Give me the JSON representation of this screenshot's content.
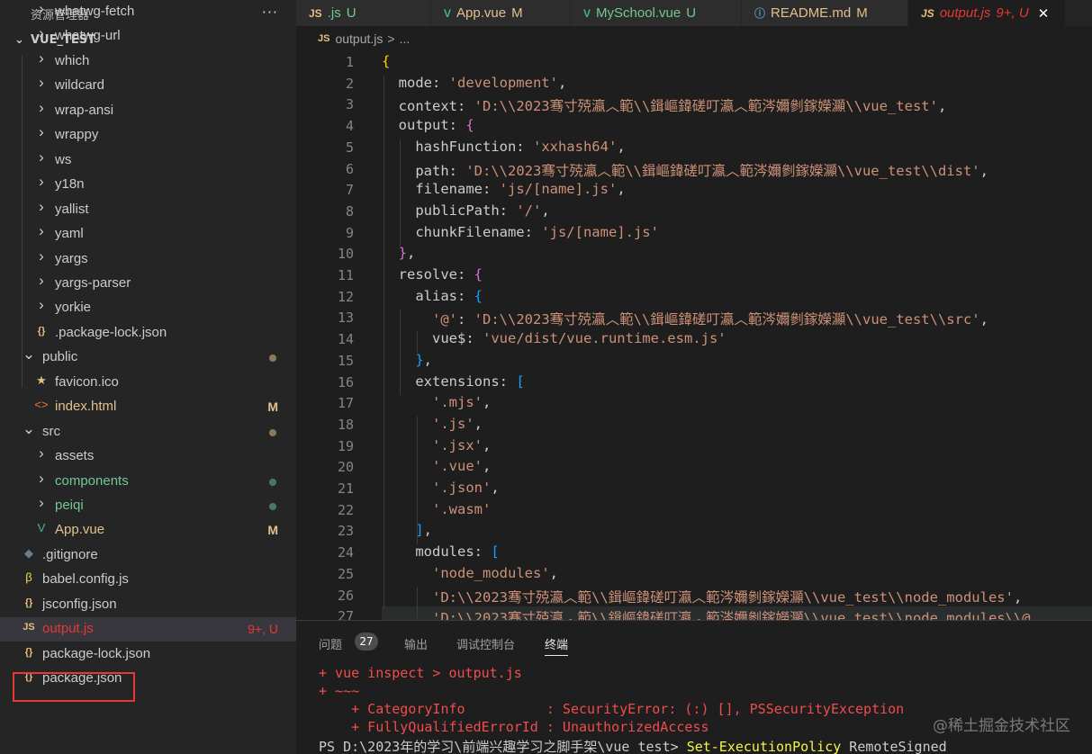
{
  "sidebar": {
    "header": "资源管理器",
    "more": "···",
    "section": "VUE_TEST",
    "items": [
      {
        "label": "whatwg-fetch",
        "icon": "chevron-right-icon",
        "kind": "folder"
      },
      {
        "label": "whatwg-url",
        "icon": "chevron-right-icon",
        "kind": "folder"
      },
      {
        "label": "which",
        "icon": "chevron-right-icon",
        "kind": "folder"
      },
      {
        "label": "wildcard",
        "icon": "chevron-right-icon",
        "kind": "folder"
      },
      {
        "label": "wrap-ansi",
        "icon": "chevron-right-icon",
        "kind": "folder"
      },
      {
        "label": "wrappy",
        "icon": "chevron-right-icon",
        "kind": "folder"
      },
      {
        "label": "ws",
        "icon": "chevron-right-icon",
        "kind": "folder"
      },
      {
        "label": "y18n",
        "icon": "chevron-right-icon",
        "kind": "folder"
      },
      {
        "label": "yallist",
        "icon": "chevron-right-icon",
        "kind": "folder"
      },
      {
        "label": "yaml",
        "icon": "chevron-right-icon",
        "kind": "folder"
      },
      {
        "label": "yargs",
        "icon": "chevron-right-icon",
        "kind": "folder"
      },
      {
        "label": "yargs-parser",
        "icon": "chevron-right-icon",
        "kind": "folder"
      },
      {
        "label": "yorkie",
        "icon": "chevron-right-icon",
        "kind": "folder"
      },
      {
        "label": ".package-lock.json",
        "icon": "json-braces-icon",
        "kind": "json"
      },
      {
        "label": "public",
        "icon": "chevron-down-icon",
        "kind": "open"
      },
      {
        "label": "favicon.ico",
        "icon": "star-icon",
        "kind": "ico"
      },
      {
        "label": "index.html",
        "icon": "html-icon",
        "kind": "html",
        "badge": "M"
      },
      {
        "label": "src",
        "icon": "chevron-down-icon",
        "kind": "open"
      },
      {
        "label": "assets",
        "icon": "chevron-right-icon",
        "kind": "folder"
      },
      {
        "label": "components",
        "icon": "chevron-right-icon",
        "kind": "folder-green"
      },
      {
        "label": "peiqi",
        "icon": "chevron-right-icon",
        "kind": "folder-green"
      },
      {
        "label": "App.vue",
        "icon": "vue-icon",
        "kind": "vue",
        "badge": "M"
      },
      {
        "label": ".gitignore",
        "icon": "git-icon",
        "kind": "git"
      },
      {
        "label": "babel.config.js",
        "icon": "babel-icon",
        "kind": "babel"
      },
      {
        "label": "jsconfig.json",
        "icon": "json-braces-icon",
        "kind": "json"
      },
      {
        "label": "output.js",
        "icon": "js-icon",
        "kind": "js",
        "badge": "9+, U"
      },
      {
        "label": "package-lock.json",
        "icon": "json-braces-icon",
        "kind": "json"
      },
      {
        "label": "package.json",
        "icon": "json-braces-icon",
        "kind": "json"
      }
    ]
  },
  "tabs": [
    {
      "icon": "JS",
      "label": ".js",
      "status": "U"
    },
    {
      "icon": "V",
      "label": "App.vue",
      "status": "M"
    },
    {
      "icon": "V",
      "label": "MySchool.vue",
      "status": "U"
    },
    {
      "icon": "ⓘ",
      "label": "README.md",
      "status": "M"
    },
    {
      "icon": "JS",
      "label": "output.js",
      "status": "9+, U",
      "close": "✕"
    }
  ],
  "breadcrumb": {
    "icon": "JS",
    "file": "output.js",
    "sep": ">",
    "rest": "..."
  },
  "editor": {
    "lines": [
      {
        "n": "1",
        "parts": [
          [
            "b1",
            "{"
          ]
        ]
      },
      {
        "n": "2",
        "parts": [
          [
            "k",
            "  mode: "
          ],
          [
            "s",
            "'development'"
          ],
          [
            "p",
            ","
          ]
        ]
      },
      {
        "n": "3",
        "parts": [
          [
            "k",
            "  context: "
          ],
          [
            "s",
            "'D:\\\\2023骞寸殑瀛︿範\\\\鍓嶇鍏磋叮瀛︿範涔嬭剼鎵嬫灦\\\\vue_test'"
          ],
          [
            "p",
            ","
          ]
        ]
      },
      {
        "n": "4",
        "parts": [
          [
            "k",
            "  output: "
          ],
          [
            "b2",
            "{"
          ]
        ]
      },
      {
        "n": "5",
        "parts": [
          [
            "k",
            "    hashFunction: "
          ],
          [
            "s",
            "'xxhash64'"
          ],
          [
            "p",
            ","
          ]
        ]
      },
      {
        "n": "6",
        "parts": [
          [
            "k",
            "    path: "
          ],
          [
            "s",
            "'D:\\\\2023骞寸殑瀛︿範\\\\鍓嶇鍏磋叮瀛︿範涔嬭剼鎵嬫灦\\\\vue_test\\\\dist'"
          ],
          [
            "p",
            ","
          ]
        ]
      },
      {
        "n": "7",
        "parts": [
          [
            "k",
            "    filename: "
          ],
          [
            "s",
            "'js/[name].js'"
          ],
          [
            "p",
            ","
          ]
        ]
      },
      {
        "n": "8",
        "parts": [
          [
            "k",
            "    publicPath: "
          ],
          [
            "s",
            "'/'"
          ],
          [
            "p",
            ","
          ]
        ]
      },
      {
        "n": "9",
        "parts": [
          [
            "k",
            "    chunkFilename: "
          ],
          [
            "s",
            "'js/[name].js'"
          ]
        ]
      },
      {
        "n": "10",
        "parts": [
          [
            "k",
            "  "
          ],
          [
            "b2",
            "}"
          ],
          [
            "p",
            ","
          ]
        ]
      },
      {
        "n": "11",
        "parts": [
          [
            "k",
            "  resolve: "
          ],
          [
            "b2",
            "{"
          ]
        ]
      },
      {
        "n": "12",
        "parts": [
          [
            "k",
            "    alias: "
          ],
          [
            "b3",
            "{"
          ]
        ]
      },
      {
        "n": "13",
        "parts": [
          [
            "k",
            "      "
          ],
          [
            "s",
            "'@'"
          ],
          [
            "k",
            ": "
          ],
          [
            "s",
            "'D:\\\\2023骞寸殑瀛︿範\\\\鍓嶇鍏磋叮瀛︿範涔嬭剼鎵嬫灦\\\\vue_test\\\\src'"
          ],
          [
            "p",
            ","
          ]
        ]
      },
      {
        "n": "14",
        "parts": [
          [
            "k",
            "      vue$: "
          ],
          [
            "s",
            "'vue/dist/vue.runtime.esm.js'"
          ]
        ]
      },
      {
        "n": "15",
        "parts": [
          [
            "k",
            "    "
          ],
          [
            "b3",
            "}"
          ],
          [
            "p",
            ","
          ]
        ]
      },
      {
        "n": "16",
        "parts": [
          [
            "k",
            "    extensions: "
          ],
          [
            "b3",
            "["
          ]
        ]
      },
      {
        "n": "17",
        "parts": [
          [
            "k",
            "      "
          ],
          [
            "s",
            "'.mjs'"
          ],
          [
            "p",
            ","
          ]
        ]
      },
      {
        "n": "18",
        "parts": [
          [
            "k",
            "      "
          ],
          [
            "s",
            "'.js'"
          ],
          [
            "p",
            ","
          ]
        ]
      },
      {
        "n": "19",
        "parts": [
          [
            "k",
            "      "
          ],
          [
            "s",
            "'.jsx'"
          ],
          [
            "p",
            ","
          ]
        ]
      },
      {
        "n": "20",
        "parts": [
          [
            "k",
            "      "
          ],
          [
            "s",
            "'.vue'"
          ],
          [
            "p",
            ","
          ]
        ]
      },
      {
        "n": "21",
        "parts": [
          [
            "k",
            "      "
          ],
          [
            "s",
            "'.json'"
          ],
          [
            "p",
            ","
          ]
        ]
      },
      {
        "n": "22",
        "parts": [
          [
            "k",
            "      "
          ],
          [
            "s",
            "'.wasm'"
          ]
        ]
      },
      {
        "n": "23",
        "parts": [
          [
            "k",
            "    "
          ],
          [
            "b3",
            "]"
          ],
          [
            "p",
            ","
          ]
        ]
      },
      {
        "n": "24",
        "parts": [
          [
            "k",
            "    modules: "
          ],
          [
            "b3",
            "["
          ]
        ]
      },
      {
        "n": "25",
        "parts": [
          [
            "k",
            "      "
          ],
          [
            "s",
            "'node_modules'"
          ],
          [
            "p",
            ","
          ]
        ]
      },
      {
        "n": "26",
        "parts": [
          [
            "k",
            "      "
          ],
          [
            "s",
            "'D:\\\\2023骞寸殑瀛︿範\\\\鍓嶇鍏磋叮瀛︿範涔嬭剼鎵嬫灦\\\\vue_test\\\\node_modules'"
          ],
          [
            "p",
            ","
          ]
        ]
      },
      {
        "n": "27",
        "parts": [
          [
            "k",
            "      "
          ],
          [
            "s",
            "'D:\\\\2023骞寸殑瀛︿範\\\\鍓嶇鍏磋叮瀛︿範涔嬭剼鎵嬫灦\\\\vue_test\\\\node_modules\\\\@"
          ]
        ]
      }
    ]
  },
  "panel": {
    "tabs": [
      "问题",
      "输出",
      "调试控制台",
      "终端"
    ],
    "problem_count": "27",
    "terminal": [
      "+ vue inspect > output.js",
      "+ ~~~",
      "    + CategoryInfo          : SecurityError: (:) [], PSSecurityException",
      "    + FullyQualifiedErrorId : UnauthorizedAccess"
    ],
    "prompt": "PS D:\\2023年的学习\\前端兴趣学习之脚手架\\vue_test> ",
    "command": "Set-ExecutionPolicy",
    "command_arg": " RemoteSigned"
  },
  "watermark": "@稀土掘金技术社区",
  "colors": {
    "accent": "#e53935",
    "modified": "#e2c08d",
    "untracked": "#73c991"
  }
}
